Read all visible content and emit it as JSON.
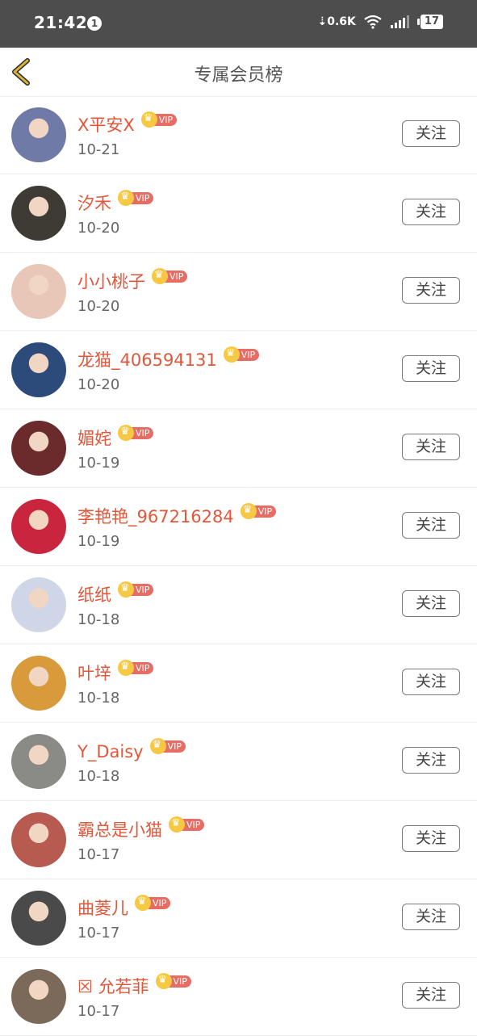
{
  "status_bar": {
    "time": "21:42",
    "notification_count": "1",
    "net_speed": "0.6K",
    "battery": "17"
  },
  "header": {
    "title": "专属会员榜",
    "back_icon": "chevron-left-icon"
  },
  "vip_label": "VIP",
  "follow_label": "关注",
  "accent_colors": {
    "name": "#e2563a",
    "vip_tag": "#e76c64",
    "crown": "#f6c843",
    "back": "#c9a22a"
  },
  "members": [
    {
      "name": "X平安X",
      "date": "10-21",
      "avatar_color": "#6f7aa6"
    },
    {
      "name": "汐禾",
      "date": "10-20",
      "avatar_color": "#3e3a34"
    },
    {
      "name": "小小桃子",
      "date": "10-20",
      "avatar_color": "#e9c7b8"
    },
    {
      "name": "龙猫_406594131",
      "date": "10-20",
      "avatar_color": "#2c4a7a"
    },
    {
      "name": "媚姹",
      "date": "10-19",
      "avatar_color": "#6b2a2c"
    },
    {
      "name": "李艳艳_967216284",
      "date": "10-19",
      "avatar_color": "#c9253f"
    },
    {
      "name": "纸纸",
      "date": "10-18",
      "avatar_color": "#cfd6e8"
    },
    {
      "name": "叶垶",
      "date": "10-18",
      "avatar_color": "#d89a3a"
    },
    {
      "name": "Y_Daisy",
      "date": "10-18",
      "avatar_color": "#8a8a86"
    },
    {
      "name": "霸总是小猫",
      "date": "10-17",
      "avatar_color": "#b75a4f"
    },
    {
      "name": "曲菱儿",
      "date": "10-17",
      "avatar_color": "#4a4a4a"
    },
    {
      "name": "☒ 允若菲",
      "date": "10-17",
      "avatar_color": "#7b6a5a"
    }
  ]
}
